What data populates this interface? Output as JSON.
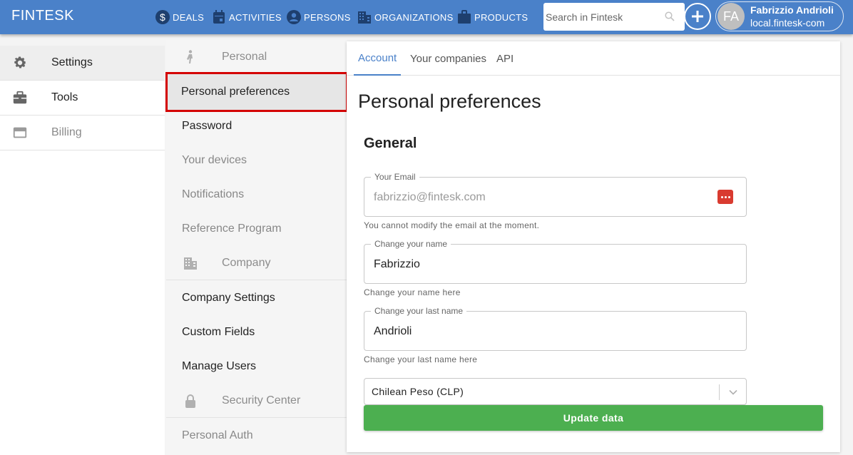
{
  "app": {
    "brand": "FINTESK"
  },
  "nav": {
    "deals": "DEALS",
    "activities": "ACTIVITIES",
    "persons": "PERSONS",
    "organizations": "ORGANIZATIONS",
    "products": "PRODUCTS"
  },
  "search": {
    "placeholder": "Search in Fintesk"
  },
  "user": {
    "initials": "FA",
    "name": "Fabrizzio Andrioli",
    "domain": "local.fintesk-com"
  },
  "sidebar": {
    "items": [
      {
        "label": "Settings",
        "icon": "gear-icon"
      },
      {
        "label": "Tools",
        "icon": "toolbox-icon"
      },
      {
        "label": "Billing",
        "icon": "credit-card-icon"
      }
    ]
  },
  "submenu": {
    "personal_header": "Personal",
    "personal_preferences": "Personal preferences",
    "password": "Password",
    "your_devices": "Your devices",
    "notifications": "Notifications",
    "reference_program": "Reference Program",
    "company_header": "Company",
    "company_settings": "Company Settings",
    "custom_fields": "Custom Fields",
    "manage_users": "Manage Users",
    "security_header": "Security Center",
    "personal_auth": "Personal Auth"
  },
  "tabs": {
    "account": "Account",
    "companies": "Your companies",
    "api": "API"
  },
  "main": {
    "title": "Personal preferences",
    "section": "General",
    "email": {
      "legend": "Your Email",
      "value": "fabrizzio@fintesk.com",
      "helper": "You cannot modify the email at the moment."
    },
    "first_name": {
      "legend": "Change your name",
      "value": "Fabrizzio",
      "helper": "Change your name here"
    },
    "last_name": {
      "legend": "Change your last name",
      "value": "Andrioli",
      "helper": "Change your last name here"
    },
    "currency": "Chilean Peso (CLP)",
    "update_label": "Update data"
  },
  "colors": {
    "topbar": "#4a81c9",
    "accent": "#4a81c9",
    "highlight_border": "#d40000",
    "update_button": "#4caf50"
  }
}
